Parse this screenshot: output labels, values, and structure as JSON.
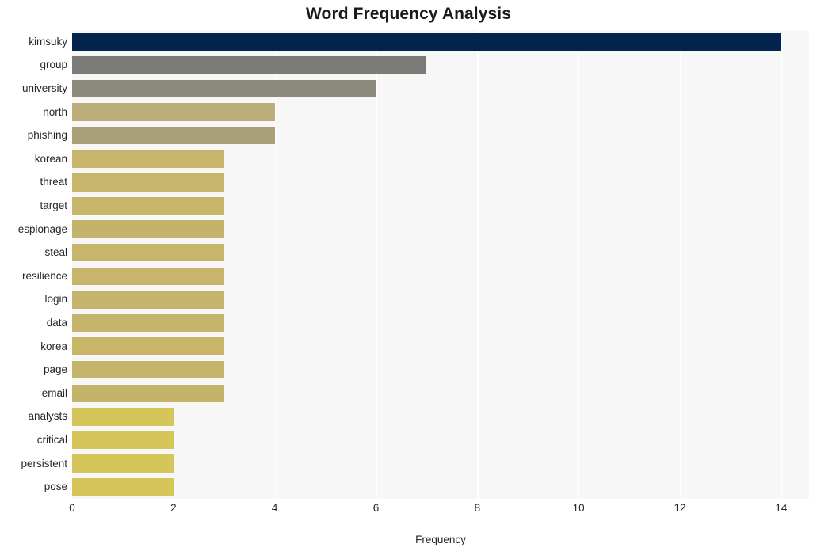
{
  "chart_data": {
    "type": "bar",
    "orientation": "horizontal",
    "title": "Word Frequency Analysis",
    "xlabel": "Frequency",
    "ylabel": "",
    "xlim": [
      0,
      14.55
    ],
    "xticks": [
      0,
      2,
      4,
      6,
      8,
      10,
      12,
      14
    ],
    "xticklabels": [
      "0",
      "2",
      "4",
      "6",
      "8",
      "10",
      "12",
      "14"
    ],
    "grid": "vertical-only",
    "legend": "none",
    "categories": [
      "kimsuky",
      "group",
      "university",
      "north",
      "phishing",
      "korean",
      "threat",
      "target",
      "espionage",
      "steal",
      "resilience",
      "login",
      "data",
      "korea",
      "page",
      "email",
      "analysts",
      "critical",
      "persistent",
      "pose"
    ],
    "values": [
      14,
      7,
      6,
      4,
      4,
      3,
      3,
      3,
      3,
      3,
      3,
      3,
      3,
      3,
      3,
      3,
      2,
      2,
      2,
      2
    ],
    "bar_colors": [
      "#04244d",
      "#7b7a76",
      "#8b8a7b",
      "#bbae78",
      "#a99f78",
      "#c6b56a",
      "#c6b56a",
      "#c6b56a",
      "#c4b46b",
      "#c6b56a",
      "#c6b56a",
      "#c5b46b",
      "#c5b46b",
      "#c7b668",
      "#c5b46b",
      "#c4b46b",
      "#d6c558",
      "#d6c558",
      "#d6c558",
      "#d6c558"
    ],
    "plot_background": "#f7f7f7",
    "gridline_color": "#ffffff",
    "figure_background": "#ffffff",
    "text_color": "#262626"
  }
}
